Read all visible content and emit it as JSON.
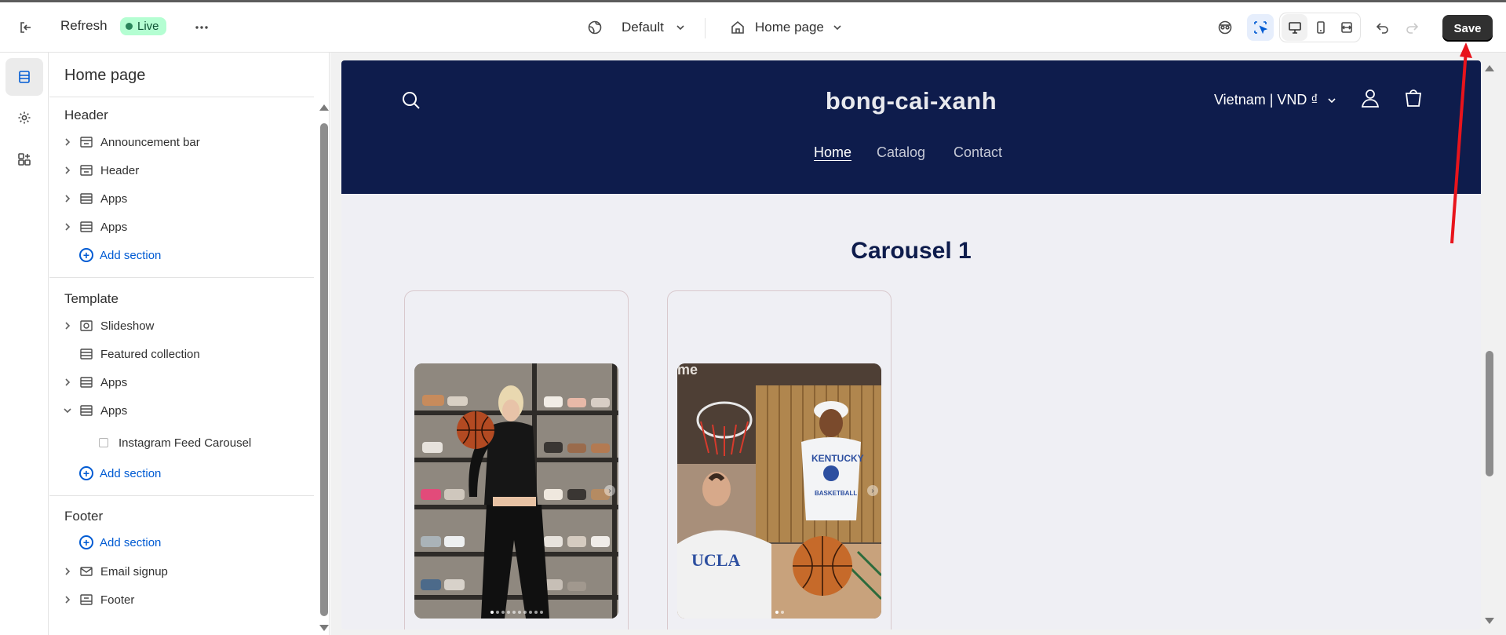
{
  "topbar": {
    "refresh_label": "Refresh",
    "live_label": "Live",
    "theme_label": "Default",
    "page_label": "Home page",
    "save_label": "Save"
  },
  "panel": {
    "title": "Home page",
    "groups": {
      "header": {
        "label": "Header",
        "items": [
          "Announcement bar",
          "Header",
          "Apps",
          "Apps"
        ],
        "add_label": "Add section"
      },
      "template": {
        "label": "Template",
        "items": [
          "Slideshow",
          "Featured collection",
          "Apps",
          "Apps"
        ],
        "child": "Instagram Feed Carousel",
        "add_label": "Add section"
      },
      "footer": {
        "label": "Footer",
        "add_label": "Add section",
        "items": [
          "Email signup",
          "Footer"
        ]
      }
    }
  },
  "site": {
    "brand": "bong-cai-xanh",
    "nav": [
      "Home",
      "Catalog",
      "Contact"
    ],
    "currency": "Vietnam | VND ₫",
    "section_title": "Carousel 1"
  },
  "icons": {
    "exit": "exit-icon",
    "more": "more-horizontal-icon",
    "globe": "globe-icon",
    "home": "home-icon",
    "accessibility": "accessibility-icon",
    "inspector": "select-cursor-icon",
    "desktop": "desktop-icon",
    "mobile": "mobile-icon",
    "fullwidth": "full-width-icon",
    "undo": "undo-icon",
    "redo": "redo-icon"
  },
  "colors": {
    "brand_navy": "#0e1c4c",
    "accent_blue": "#005bd3",
    "live_bg": "#b4fed2",
    "save_bg": "#303030"
  }
}
